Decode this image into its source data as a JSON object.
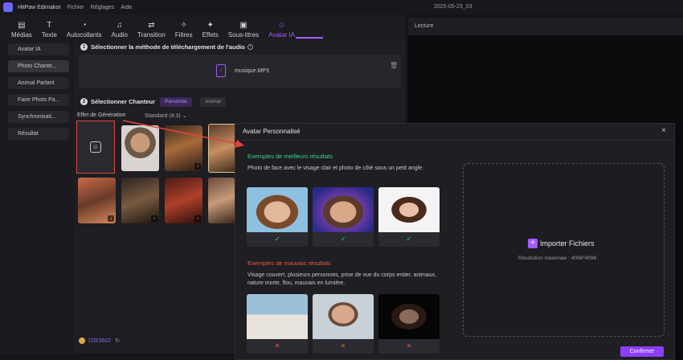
{
  "app": {
    "name": "HitPaw Edimakor",
    "project_title": "2025-05-23_03"
  },
  "menu": [
    "Fichier",
    "Réglages",
    "Aide"
  ],
  "toolbar": {
    "tabs": [
      {
        "label": "Médias",
        "icon": "media-icon"
      },
      {
        "label": "Texte",
        "icon": "text-icon"
      },
      {
        "label": "Autocollants",
        "icon": "sticker-icon"
      },
      {
        "label": "Audio",
        "icon": "audio-icon"
      },
      {
        "label": "Transition",
        "icon": "transition-icon"
      },
      {
        "label": "Filtres",
        "icon": "filter-icon"
      },
      {
        "label": "Effets",
        "icon": "effects-icon"
      },
      {
        "label": "Sous-titres",
        "icon": "subtitles-icon"
      },
      {
        "label": "Avatar IA",
        "icon": "avatar-icon",
        "active": true
      }
    ]
  },
  "preview": {
    "label": "Lecture"
  },
  "sidebar": {
    "items": [
      {
        "label": "Avatar IA"
      },
      {
        "label": "Photo Chanteur",
        "display": "Photo Chante..."
      },
      {
        "label": "Animal Parlant"
      },
      {
        "label": "Faire Photo Parler",
        "display": "Faire Photo Pa..."
      },
      {
        "label": "Synchronisation",
        "display": "Synchronisati..."
      },
      {
        "label": "Résultat"
      }
    ]
  },
  "main": {
    "step1": {
      "num": "1",
      "title": "Sélectionner la méthode de téléchargement de l'audio"
    },
    "upload": {
      "file_name": "musique.MP3"
    },
    "step2": {
      "num": "2",
      "title": "Sélectionner Chanteur"
    },
    "pills": {
      "person": "Personne",
      "animal": "Animal"
    },
    "generation": {
      "label": "Effet de Génération",
      "value": "Standard (4:3)"
    },
    "credits": {
      "value": "720/3602"
    }
  },
  "modal": {
    "title": "Avatar Personnalisé",
    "good": {
      "title": "Exemples de meilleurs résultats",
      "desc": "Photo de face avec le visage clair et photo de côté sous un petit angle.",
      "mark": "✓"
    },
    "bad": {
      "title": "Exemples de mauvais résultats",
      "desc": "Visage couvert, plusieurs personnes, prise de vue du corps entier, animaux, nature morte, flou, mauvais en lumière.",
      "mark": "✕"
    },
    "dropzone": {
      "button": "Importer Fichiers",
      "resolution": "Résolution maximale : 4096*4096"
    },
    "confirm": "Confirmer",
    "close": "×"
  },
  "colors": {
    "accent": "#a45cff",
    "good": "#3ed38a",
    "bad": "#e85a4a",
    "highlight": "#e0453a"
  }
}
